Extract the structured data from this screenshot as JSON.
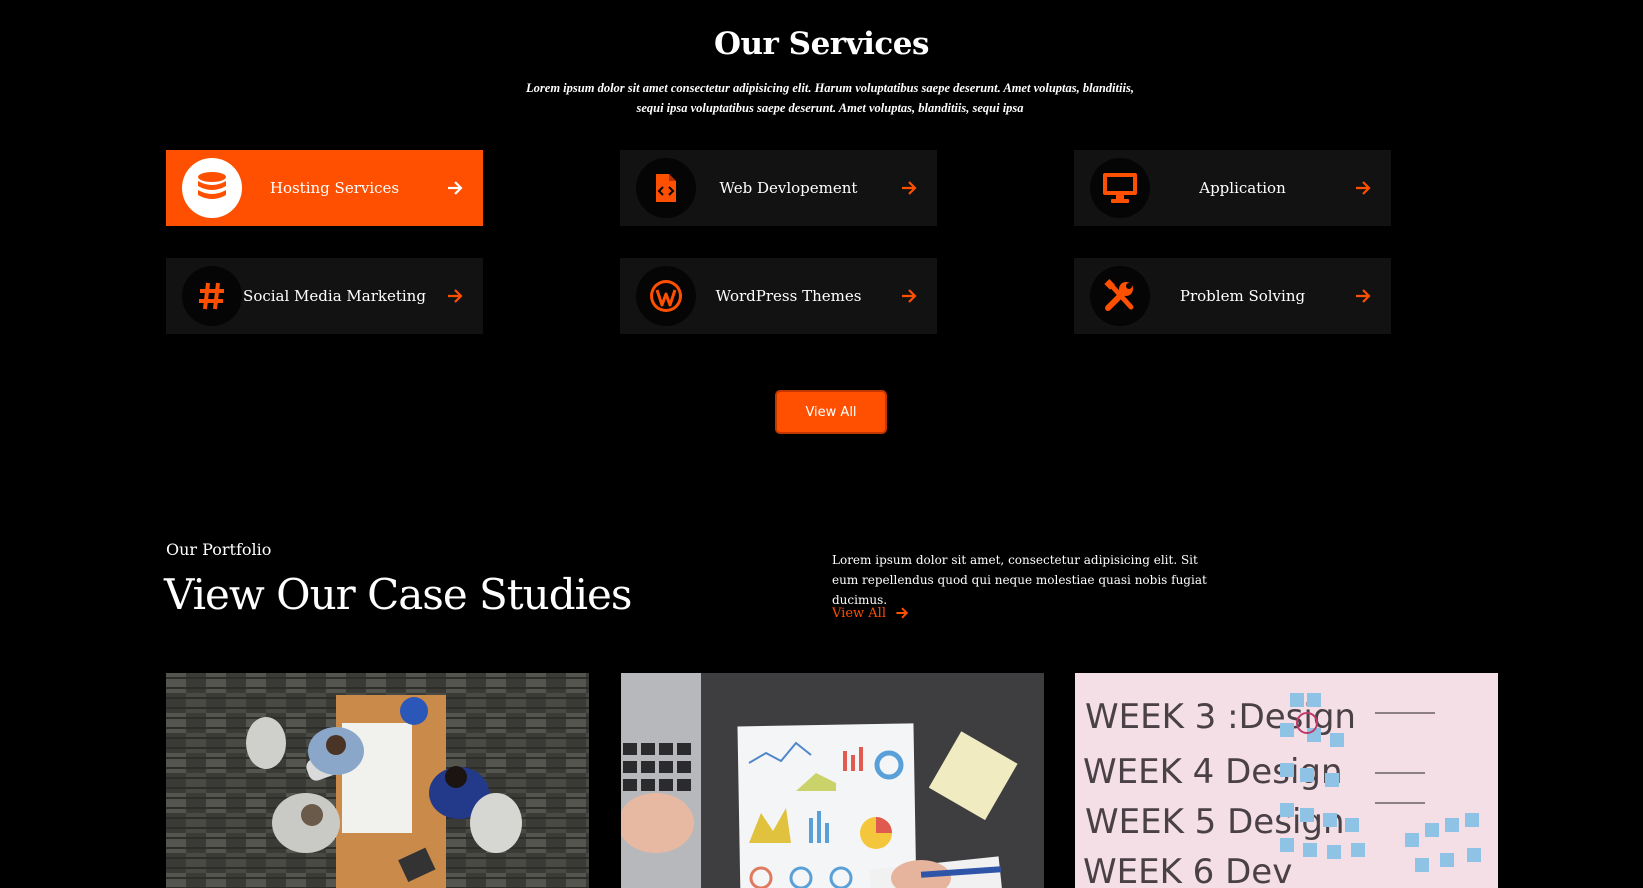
{
  "services": {
    "title": "Our Services",
    "description_line1": "Lorem ipsum dolor sit amet consectetur adipisicing elit. Harum voluptatibus saepe deserunt. Amet voluptas, blanditiis,",
    "description_line2": "sequi ipsa voluptatibus saepe deserunt. Amet voluptas, blanditiis, sequi ipsa",
    "items": [
      {
        "label": "Hosting Services",
        "icon": "database-icon"
      },
      {
        "label": "Web Devlopement",
        "icon": "code-file-icon"
      },
      {
        "label": "Application",
        "icon": "desktop-icon"
      },
      {
        "label": "Social Media Marketing",
        "icon": "hashtag-icon"
      },
      {
        "label": "WordPress Themes",
        "icon": "wordpress-icon"
      },
      {
        "label": "Problem Solving",
        "icon": "tools-icon"
      }
    ],
    "view_all_label": "View All"
  },
  "portfolio": {
    "subtitle": "Our Portfolio",
    "title": "View Our Case Studies",
    "description_line1": "Lorem ipsum dolor sit amet, consectetur adipisicing elit. Sit",
    "description_line2": "eum repellendus quod qui neque molestiae quasi nobis fugiat ducimus.",
    "view_all_label": "View All",
    "images": [
      {
        "alt": "Team meeting from above"
      },
      {
        "alt": "Analytics report on desk"
      },
      {
        "alt": "Whiteboard with sticky notes"
      }
    ],
    "whiteboard_text": [
      "WEEK 3 :Design",
      "WEEK 4 Design",
      "WEEK 5 Design",
      "WEEK 6 Dev"
    ]
  },
  "colors": {
    "accent": "#ff4f00",
    "card_bg": "#121212",
    "background": "#000000"
  }
}
